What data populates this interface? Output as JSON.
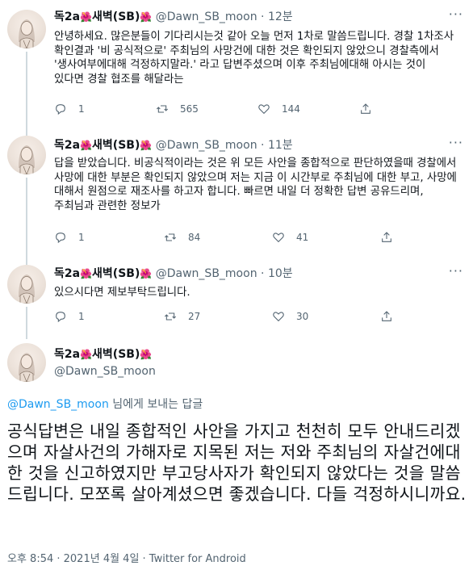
{
  "author": {
    "name": "독2a",
    "flower": "🌺",
    "name2": "새벽(SB)",
    "handle": "@Dawn_SB_moon"
  },
  "tweets": [
    {
      "time": "12분",
      "text": "안녕하세요. 많은분들이 기다리시는것 같아 오늘 먼저 1차로 말씀드립니다. 경찰 1차조사 확인결과 '비 공식적으로' 주최님의 사망건에 대한 것은 확인되지 않았으니 경찰측에서 '생사여부에대해 걱정하지말라.' 라고 답변주셨으며 이후 주최님에대해 아시는 것이 있다면 경찰 협조를 해달라는",
      "replies": "1",
      "retweets": "565",
      "likes": "144"
    },
    {
      "time": "11분",
      "text": "답을 받았습니다. 비공식적이라는 것은 위 모든 사안을 종합적으로 판단하였을때 경찰에서 사망에 대한 부분은 확인되지 않았으며 저는 지금 이 시간부로 주최님에 대한 부고, 사망에 대해서 원점으로 재조사를 하고자 합니다. 빠르면 내일 더 정확한 답변 공유드리며, 주최님과 관련한 정보가",
      "replies": "1",
      "retweets": "84",
      "likes": "41"
    },
    {
      "time": "10분",
      "text": "있으시다면 제보부탁드립니다.",
      "replies": "1",
      "retweets": "27",
      "likes": "30"
    }
  ],
  "main": {
    "reply_link": "@Dawn_SB_moon",
    "reply_suffix": " 님에게 보내는 답글",
    "text": "공식답변은 내일 종합적인 사안을 가지고 천천히 모두 안내드리겠으며 자살사건의 가해자로 지목된 저는 저와 주최님의 자살건에대한 것을 신고하였지만 부고당사자가 확인되지 않았다는 것을 말씀드립니다. 모쪼록 살아계셨으면 좋겠습니다. 다들 걱정하시니까요.",
    "meta": "오후 8:54 · 2021년 4월 4일 · Twitter for Android"
  },
  "icons": {
    "more": "more-icon",
    "reply": "reply-icon",
    "retweet": "retweet-icon",
    "like": "heart-icon",
    "share": "share-icon"
  },
  "colors": {
    "link": "#1d9bf0",
    "secondary": "#536471",
    "thread_line": "#cfd9de"
  }
}
